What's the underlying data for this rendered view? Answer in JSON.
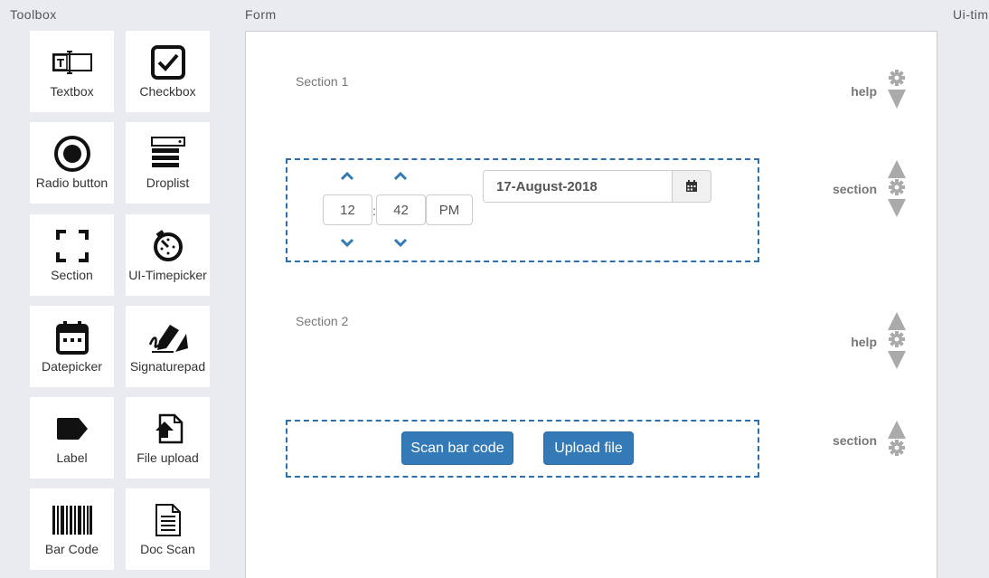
{
  "panels": {
    "toolbox": "Toolbox",
    "form": "Form",
    "right": "Ui-tim"
  },
  "toolbox": {
    "items": [
      {
        "label": "Textbox",
        "icon": "textbox-icon"
      },
      {
        "label": "Checkbox",
        "icon": "checkbox-icon"
      },
      {
        "label": "Radio button",
        "icon": "radio-icon"
      },
      {
        "label": "Droplist",
        "icon": "droplist-icon"
      },
      {
        "label": "Section",
        "icon": "section-icon"
      },
      {
        "label": "UI-Timepicker",
        "icon": "timepicker-icon"
      },
      {
        "label": "Datepicker",
        "icon": "calendar-icon"
      },
      {
        "label": "Signaturepad",
        "icon": "signature-icon"
      },
      {
        "label": "Label",
        "icon": "label-icon"
      },
      {
        "label": "File upload",
        "icon": "file-upload-icon"
      },
      {
        "label": "Bar Code",
        "icon": "barcode-icon"
      },
      {
        "label": "Doc Scan",
        "icon": "document-icon"
      }
    ]
  },
  "form": {
    "section1": {
      "title": "Section 1",
      "control_label": "help"
    },
    "section1_body": {
      "control_label": "section",
      "timepicker": {
        "hour": "12",
        "minute": "42",
        "meridian": "PM",
        "separator": ":"
      },
      "date_value": "17-August-2018"
    },
    "section2": {
      "title": "Section 2",
      "control_label": "help"
    },
    "section2_body": {
      "control_label": "section",
      "scan_button": "Scan bar code",
      "upload_button": "Upload file"
    }
  }
}
